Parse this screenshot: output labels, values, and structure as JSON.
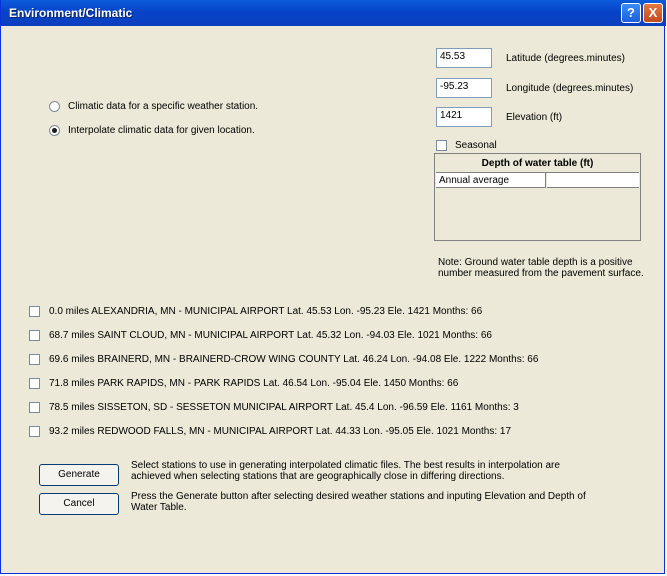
{
  "window": {
    "title": "Environment/Climatic",
    "help_label": "?",
    "close_label": "X"
  },
  "mode_options": [
    {
      "label": "Climatic data for a specific weather station.",
      "selected": false
    },
    {
      "label": "Interpolate climatic data  for given location.",
      "selected": true
    }
  ],
  "location": {
    "latitude": {
      "value": "45.53",
      "label": "Latitude (degrees.minutes)"
    },
    "longitude": {
      "value": "-95.23",
      "label": "Longitude (degrees.minutes)"
    },
    "elevation": {
      "value": "1421",
      "label": "Elevation (ft)"
    }
  },
  "seasonal": {
    "label": "Seasonal",
    "checked": false
  },
  "water_table": {
    "header": "Depth of water table (ft)",
    "rows": [
      {
        "label": "Annual average",
        "value": ""
      }
    ]
  },
  "note": "Note: Ground water table depth is a positive number measured from the pavement surface.",
  "stations": [
    {
      "checked": false,
      "text": "0.0 miles ALEXANDRIA, MN - MUNICIPAL AIRPORT  Lat. 45.53  Lon. -95.23  Ele. 1421  Months: 66"
    },
    {
      "checked": false,
      "text": "68.7 miles SAINT CLOUD, MN - MUNICIPAL AIRPORT  Lat. 45.32  Lon. -94.03  Ele. 1021  Months: 66"
    },
    {
      "checked": false,
      "text": "69.6 miles BRAINERD, MN - BRAINERD-CROW WING COUNTY  Lat. 46.24  Lon. -94.08  Ele. 1222  Months: 66"
    },
    {
      "checked": false,
      "text": "71.8 miles PARK RAPIDS, MN - PARK RAPIDS  Lat. 46.54  Lon. -95.04  Ele. 1450  Months: 66"
    },
    {
      "checked": false,
      "text": "78.5 miles SISSETON, SD - SESSETON MUNICIPAL AIRPORT  Lat. 45.4  Lon. -96.59  Ele. 1161  Months: 3"
    },
    {
      "checked": false,
      "text": "93.2 miles REDWOOD FALLS, MN - MUNICIPAL AIRPORT  Lat. 44.33  Lon. -95.05  Ele. 1021  Months: 17"
    }
  ],
  "actions": {
    "generate_label": "Generate",
    "cancel_label": "Cancel",
    "help_text_1": "Select stations to use in generating interpolated climatic files.   The best results in interpolation are achieved when selecting stations that are geographically close in differing directions.",
    "help_text_2": "Press the Generate button after selecting desired weather stations and inputing Elevation and Depth of Water Table."
  }
}
